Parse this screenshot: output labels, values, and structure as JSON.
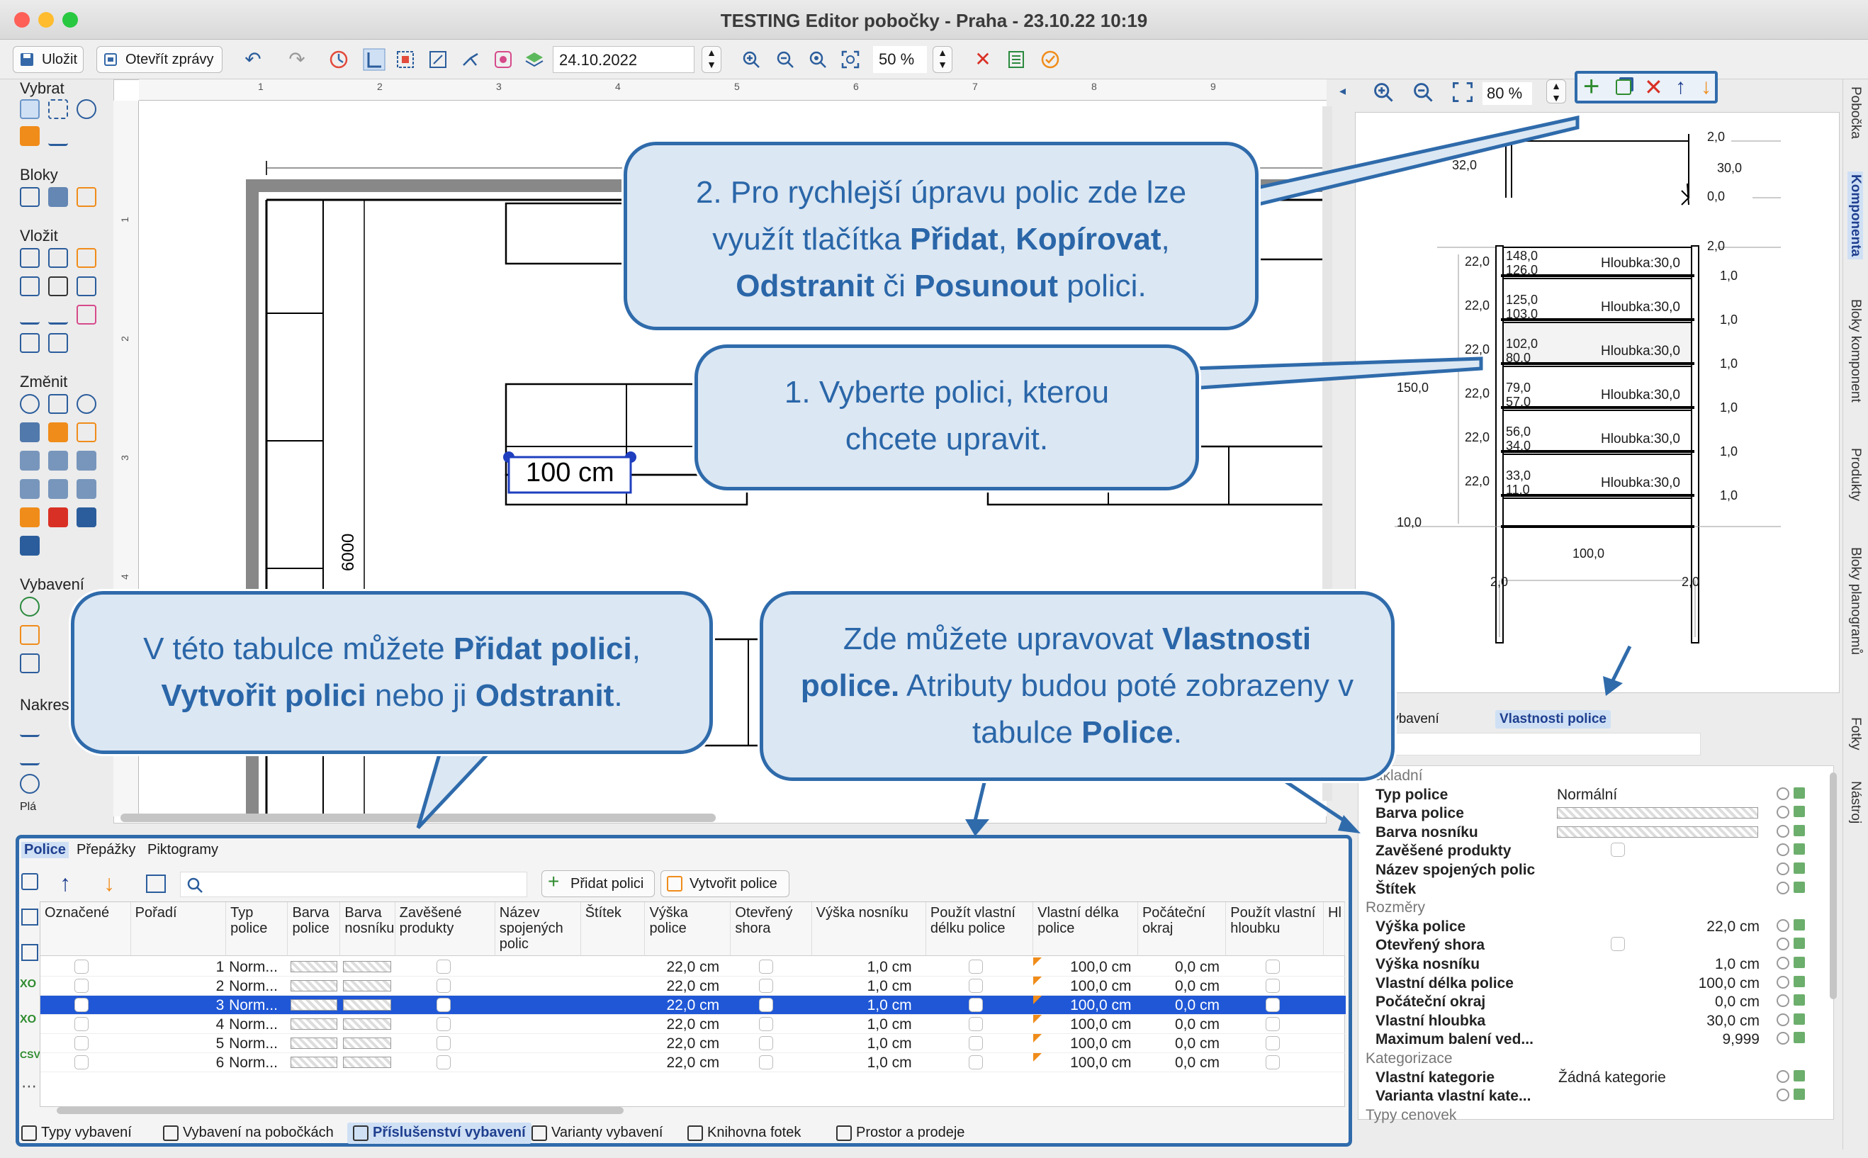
{
  "window": {
    "title": "TESTING Editor pobočky - Praha - 23.10.22 10:19"
  },
  "toolbar": {
    "save_label": "Uložit",
    "open_reports_label": "Otevřít zprávy",
    "date_value": "24.10.2022",
    "zoom_value": "50 %"
  },
  "left_tools": {
    "sections": [
      "Vybrat",
      "Bloky",
      "Vložit",
      "Změnit",
      "Vybavení",
      "Nakres",
      "Plá"
    ]
  },
  "canvas": {
    "selected_label": "100 cm",
    "dimension_label": "6000",
    "ruler_top": [
      "1",
      "2",
      "3",
      "4",
      "5",
      "6",
      "7",
      "8",
      "9"
    ],
    "ruler_left": [
      "1",
      "2",
      "3",
      "4"
    ]
  },
  "callouts": {
    "c2_parts": [
      "2. Pro rychlejší úpravu polic zde lze využít tlačítka ",
      "Přidat",
      ", ",
      "Kopírovat",
      ", ",
      "Odstranit",
      " či ",
      "Posunout",
      " polici."
    ],
    "c1": "1. Vyberte polici, kterou chcete upravit.",
    "c3_parts": [
      "V této tabulce můžete ",
      "Přidat polici",
      ", ",
      "Vytvořit polici",
      " nebo ji ",
      "Odstranit",
      "."
    ],
    "c4_parts": [
      "Zde můžete upravovat ",
      "Vlastnosti police.",
      " Atributy budou poté zobrazeny v tabulce ",
      "Police",
      "."
    ]
  },
  "preview": {
    "zoom_value": "80 %",
    "top_labels": {
      "a": "2,0",
      "b": "32,0",
      "c": "30,0",
      "d": "0,0",
      "e": "2,0"
    },
    "shelves": [
      {
        "top": "148,0",
        "bottom": "126,0",
        "left": "22,0",
        "depth": "Hloubka:30,0",
        "gap": "1,0"
      },
      {
        "top": "125,0",
        "bottom": "103,0",
        "left": "22,0",
        "depth": "Hloubka:30,0",
        "gap": "1,0"
      },
      {
        "top": "102,0",
        "bottom": "80,0",
        "left": "22,0",
        "depth": "Hloubka:30,0",
        "gap": "1,0"
      },
      {
        "top": "79,0",
        "bottom": "57,0",
        "left": "22,0",
        "depth": "Hloubka:30,0",
        "gap": "1,0"
      },
      {
        "top": "56,0",
        "bottom": "34,0",
        "left": "22,0",
        "depth": "Hloubka:30,0",
        "gap": "1,0"
      },
      {
        "top": "33,0",
        "bottom": "11,0",
        "left": "22,0",
        "depth": "Hloubka:30,0",
        "gap": "1,0"
      }
    ],
    "height_label": "150,0",
    "base_label": "10,0",
    "width_label": "100,0",
    "foot_left": "2,0",
    "foot_right": "2,0"
  },
  "side_tabs": [
    "Pobočka",
    "Komponenta",
    "Bloky komponent",
    "Produkty",
    "Bloky planogramů",
    "Fotky",
    "Nástroj"
  ],
  "props": {
    "tabs": [
      "tnosti vybavení",
      "Vlastnosti police"
    ],
    "rows": [
      {
        "type": "hdr",
        "label": "Základní"
      },
      {
        "label": "Typ police",
        "value": "Normální"
      },
      {
        "label": "Barva police",
        "value": ""
      },
      {
        "label": "Barva nosníku",
        "value": ""
      },
      {
        "label": "Zavěšené produkty",
        "value": ""
      },
      {
        "label": "Název spojených polic",
        "value": ""
      },
      {
        "label": "Štítek",
        "value": ""
      },
      {
        "type": "hdr",
        "label": "Rozměry"
      },
      {
        "label": "Výška police",
        "value": "22,0 cm"
      },
      {
        "label": "Otevřený shora",
        "value": ""
      },
      {
        "label": "Výška nosníku",
        "value": "1,0 cm"
      },
      {
        "label": "Vlastní délka police",
        "value": "100,0 cm"
      },
      {
        "label": "Počáteční okraj",
        "value": "0,0 cm"
      },
      {
        "label": "Vlastní hloubka",
        "value": "30,0 cm"
      },
      {
        "label": "Maximum balení ved...",
        "value": "9,999"
      },
      {
        "type": "hdr",
        "label": "Kategorizace"
      },
      {
        "label": "Vlastní kategorie",
        "value": "Žádná kategorie"
      },
      {
        "label": "Varianta vlastní kate...",
        "value": ""
      },
      {
        "type": "hdr",
        "label": "Typy cenovek"
      }
    ]
  },
  "table_panel": {
    "tabs": [
      "Police",
      "Přepážky",
      "Piktogramy"
    ],
    "add_shelf_label": "Přidat polici",
    "create_shelf_label": "Vytvořit police",
    "search_placeholder": "",
    "columns": [
      "Označené",
      "Pořadí",
      "Typ police",
      "Barva police",
      "Barva nosníku",
      "Zavěšené produkty",
      "Název spojených polic",
      "Štítek",
      "Výška police",
      "Otevřený shora",
      "Výška nosníku",
      "Použít vlastní délku police",
      "Vlastní délka police",
      "Počáteční okraj",
      "Použít vlastní hloubku",
      "Hl"
    ],
    "rows": [
      {
        "order": "1",
        "type": "Norm...",
        "height": "22,0 cm",
        "beam": "1,0 cm",
        "length": "100,0 cm",
        "margin": "0,0 cm",
        "selected": false
      },
      {
        "order": "2",
        "type": "Norm...",
        "height": "22,0 cm",
        "beam": "1,0 cm",
        "length": "100,0 cm",
        "margin": "0,0 cm",
        "selected": false
      },
      {
        "order": "3",
        "type": "Norm...",
        "height": "22,0 cm",
        "beam": "1,0 cm",
        "length": "100,0 cm",
        "margin": "0,0 cm",
        "selected": true
      },
      {
        "order": "4",
        "type": "Norm...",
        "height": "22,0 cm",
        "beam": "1,0 cm",
        "length": "100,0 cm",
        "margin": "0,0 cm",
        "selected": false
      },
      {
        "order": "5",
        "type": "Norm...",
        "height": "22,0 cm",
        "beam": "1,0 cm",
        "length": "100,0 cm",
        "margin": "0,0 cm",
        "selected": false
      },
      {
        "order": "6",
        "type": "Norm...",
        "height": "22,0 cm",
        "beam": "1,0 cm",
        "length": "100,0 cm",
        "margin": "0,0 cm",
        "selected": false
      }
    ]
  },
  "bottom_tabs": [
    "Typy vybavení",
    "Vybavení na pobočkách",
    "Příslušenství vybavení",
    "Varianty vybavení",
    "Knihovna fotek",
    "Prostor a prodeje"
  ],
  "colors": {
    "accent": "#2f6bab",
    "selection": "#1f57d6",
    "callout_bg": "#dbe7f3",
    "add_green": "#2e8b2e",
    "delete_red": "#d93025",
    "move_orange": "#f08c1a"
  }
}
